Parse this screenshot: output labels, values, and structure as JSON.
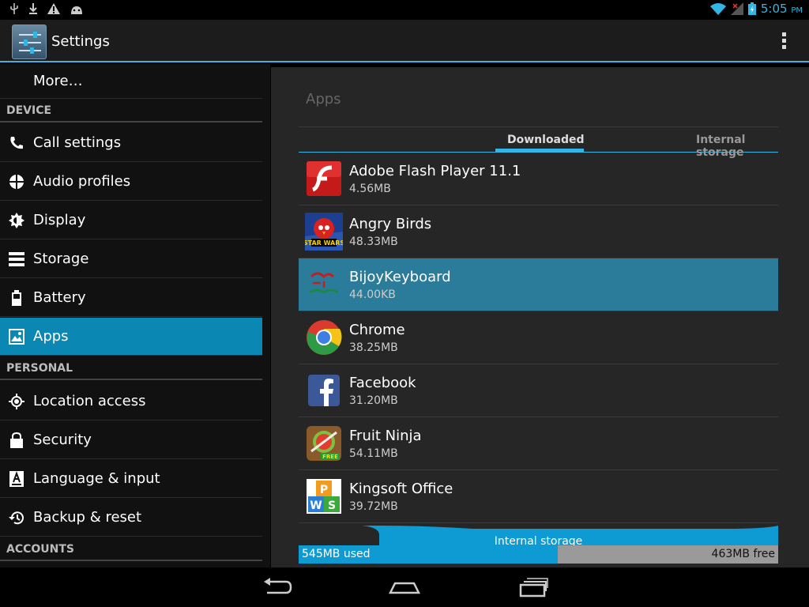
{
  "status_bar": {
    "time": "5:05",
    "ampm": "PM",
    "left_icons": [
      "usb-icon",
      "download-icon",
      "warning-icon",
      "android-icon"
    ],
    "right_icons": [
      "wifi-icon",
      "signal-icon",
      "battery-charging-icon"
    ]
  },
  "action_bar": {
    "title": "Settings",
    "icon": "settings-sliders-icon"
  },
  "sidebar": {
    "items": [
      {
        "label": "More…",
        "icon": ""
      },
      {
        "header": "DEVICE"
      },
      {
        "label": "Call settings",
        "icon": "phone-icon"
      },
      {
        "label": "Audio profiles",
        "icon": "audio-profiles-icon"
      },
      {
        "label": "Display",
        "icon": "brightness-icon"
      },
      {
        "label": "Storage",
        "icon": "storage-icon"
      },
      {
        "label": "Battery",
        "icon": "battery-icon"
      },
      {
        "label": "Apps",
        "icon": "apps-icon",
        "selected": true
      },
      {
        "header": "PERSONAL"
      },
      {
        "label": "Location access",
        "icon": "location-icon"
      },
      {
        "label": "Security",
        "icon": "lock-icon"
      },
      {
        "label": "Language & input",
        "icon": "keyboard-icon"
      },
      {
        "label": "Backup & reset",
        "icon": "backup-icon"
      },
      {
        "header": "ACCOUNTS"
      }
    ]
  },
  "main": {
    "title": "Apps",
    "tabs": [
      {
        "label": "Downloaded",
        "active": true
      },
      {
        "label": "Internal storage",
        "active": false
      }
    ],
    "apps": [
      {
        "name": "Adobe Flash Player 11.1",
        "size": "4.56MB",
        "icon": "flash-icon"
      },
      {
        "name": "Angry Birds",
        "size": "48.33MB",
        "icon": "angry-birds-icon"
      },
      {
        "name": "BijoyKeyboard",
        "size": "44.00KB",
        "icon": "bijoy-keyboard-icon",
        "selected": true
      },
      {
        "name": "Chrome",
        "size": "38.25MB",
        "icon": "chrome-icon"
      },
      {
        "name": "Facebook",
        "size": "31.20MB",
        "icon": "facebook-icon"
      },
      {
        "name": "Fruit Ninja",
        "size": "54.11MB",
        "icon": "fruit-ninja-icon"
      },
      {
        "name": "Kingsoft Office",
        "size": "39.72MB",
        "icon": "kingsoft-office-icon"
      }
    ],
    "storage": {
      "label": "Internal storage",
      "used": "545MB used",
      "free": "463MB free",
      "used_fraction": 0.541
    }
  },
  "nav_bar": {
    "buttons": [
      "back-icon",
      "home-icon",
      "recents-icon"
    ]
  },
  "colors": {
    "accent": "#33b5e5",
    "selected_item": "#0b87b3",
    "selected_app": "#2b7b9b"
  }
}
